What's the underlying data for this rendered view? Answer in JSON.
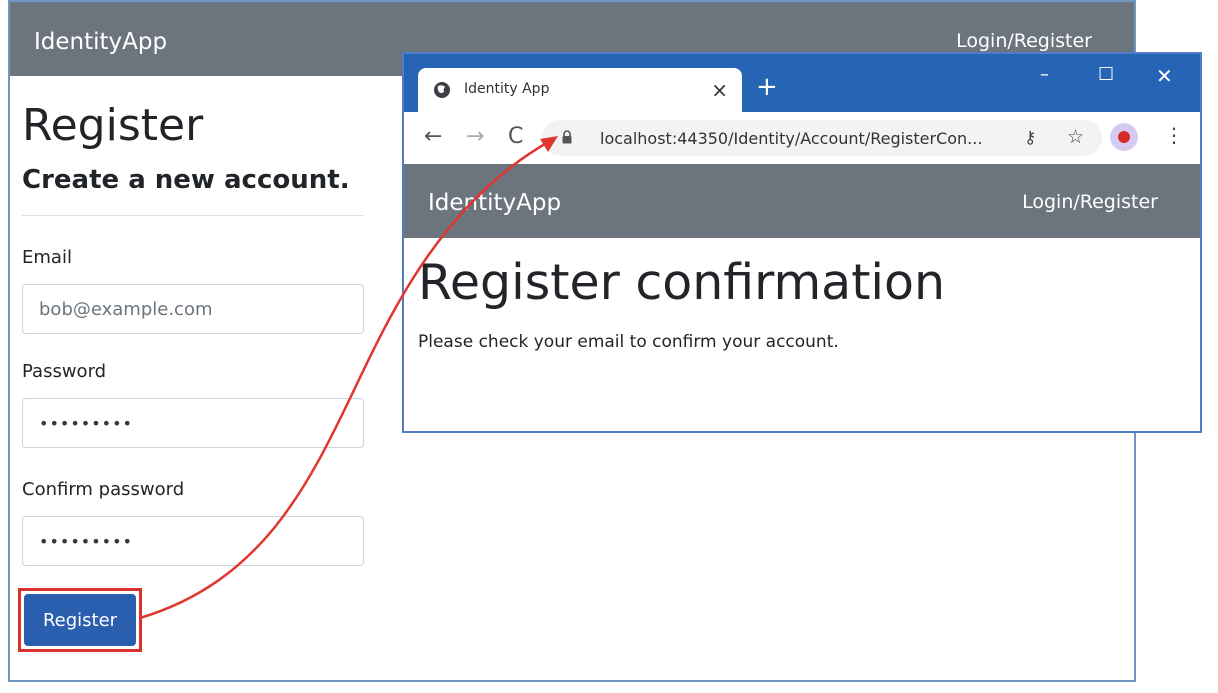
{
  "back_window": {
    "navbar": {
      "brand": "IdentityApp",
      "link": "Login/Register"
    },
    "title": "Register",
    "subtitle": "Create a new account.",
    "email": {
      "label": "Email",
      "value": "bob@example.com"
    },
    "password": {
      "label": "Password",
      "value": "•••••••••"
    },
    "confirm_password": {
      "label": "Confirm password",
      "value": "•••••••••"
    },
    "register_button": "Register"
  },
  "front_window": {
    "tab": {
      "title": "Identity App",
      "close": "×"
    },
    "new_tab": "+",
    "window_controls": {
      "minimize": "–",
      "maximize": "☐",
      "close": "✕"
    },
    "toolbar": {
      "back": "←",
      "forward": "→",
      "reload": "C",
      "star": "☆",
      "key": "⚷",
      "menu": "⋮"
    },
    "address": "localhost:44350/Identity/Account/RegisterCon...",
    "navbar": {
      "brand": "IdentityApp",
      "link": "Login/Register"
    },
    "title": "Register confirmation",
    "message": "Please check your email to confirm your account."
  },
  "colors": {
    "navbar": "#6c757d",
    "chrome_titlebar": "#2665b5",
    "button": "#2a5fb0",
    "highlight": "#d9332c"
  }
}
